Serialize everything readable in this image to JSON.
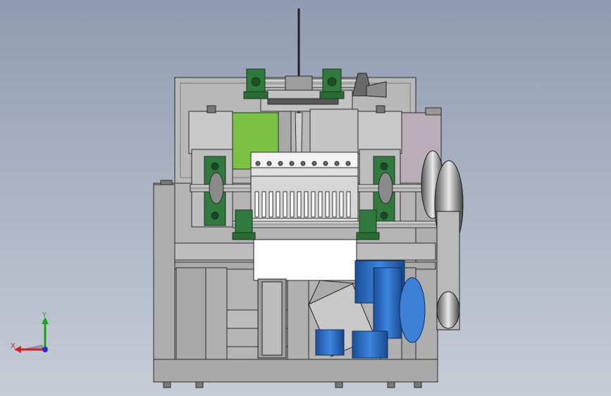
{
  "scene": {
    "background_top": "#8f9bb0",
    "background_bottom": "#c6ccd6",
    "metal_color": "#b4b4b4",
    "edge_color": "#2a2a2a",
    "bearing_color": "#2f7a3c",
    "motor_color": "#2a6fc6",
    "green_panel_color": "#7bc143",
    "pink_panel_color": "#b9aeb7"
  },
  "triad": {
    "y_label": "Y",
    "x_label": "X",
    "y_color": "#1aa11a",
    "x_color": "#cc2222",
    "z_color": "#2233cc"
  }
}
